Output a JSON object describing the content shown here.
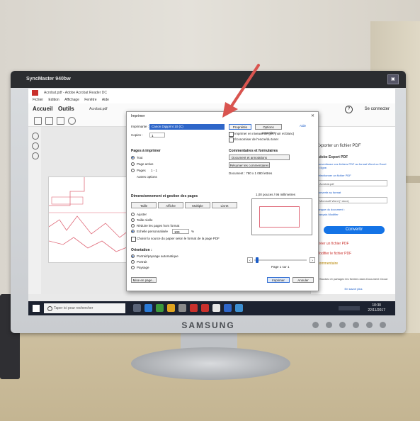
{
  "monitor": {
    "model_label": "SyncMaster 940bw",
    "brand": "SAMSUNG"
  },
  "app": {
    "window_title": "Acrobat.pdf - Adobe Acrobat Reader DC",
    "menu": [
      "Fichier",
      "Edition",
      "Affichage",
      "Fenêtre",
      "Aide"
    ],
    "tabs": [
      "Accueil",
      "Outils"
    ],
    "file_tab": "Acrobat.pdf",
    "sign_in": "Se connecter"
  },
  "dialog": {
    "title": "Imprimer",
    "printer_label": "Imprimante :",
    "printer_value": "Canon Digiprint 10 (C)",
    "properties_button": "Propriétés",
    "advanced_button": "Options avancées",
    "help_link": "Aide",
    "copies_label": "Copies :",
    "copies_value": "1",
    "grayscale_label": "Imprimer en niveaux de gris (noir et blanc)",
    "save_ink_label": "Économiser de l'encre/du toner",
    "pages_heading": "Pages à imprimer",
    "page_options": [
      "Tout",
      "Page active",
      "Pages",
      "Autres options"
    ],
    "pages_range": "1 - 1",
    "annotations_heading": "Commentaires et formulaires",
    "annotations_value": "Document et annotations",
    "summarize_button": "Résumer les commentaires",
    "document_size": "Document : 780 x 1 080 lettres",
    "sizing_heading": "Dimensionnement et gestion des pages",
    "sizing_buttons": [
      "Taille",
      "Affiche",
      "Multiple",
      "Livret"
    ],
    "fit_options": [
      "Ajuster",
      "Taille réelle",
      "Réduire les pages hors format",
      "Echelle personnalisée"
    ],
    "scale_value": "100",
    "scale_unit": "%",
    "paper_source_label": "Choisir la source du papier selon le format de la page PDF",
    "orientation_heading": "Orientation :",
    "orientation_options": [
      "Portrait/paysage automatique",
      "Portrait",
      "Paysage"
    ],
    "preview_scale": "1,00 pouces / 96 millimetres",
    "page_counter": "Page 1 sur 1",
    "page_setup_button": "Mise en page...",
    "print_button": "Imprimer",
    "cancel_button": "Annuler"
  },
  "right_panel": {
    "export_title": "Exporter un fichier PDF",
    "export_heading": "Adobe Export PDF",
    "export_desc": "Convertissez vos fichiers PDF au format Word ou Excel en ligne.",
    "select_label": "Sélectionner un fichier PDF",
    "file_value": "Acrobat.pdf",
    "convert_label": "Convertir au format",
    "format_value": "Microsoft Word (*.docx)",
    "language_label": "Langue du document :",
    "language_value": "Français Modifier",
    "convert_button": "Convertir",
    "create_pdf": "Créer un fichier PDF",
    "edit_pdf": "Modifier le fichier PDF",
    "comment": "Commentaire",
    "cloud_note": "Stockez et partagez les fichiers dans Document Cloud",
    "learn_more": "En savoir plus"
  },
  "taskbar": {
    "search_placeholder": "Taper ici pour rechercher",
    "time": "10:30",
    "date": "22/11/2017"
  },
  "colors": {
    "accent": "#1473e6",
    "arrow": "#d9544f",
    "taskbar": "#1c2230"
  }
}
